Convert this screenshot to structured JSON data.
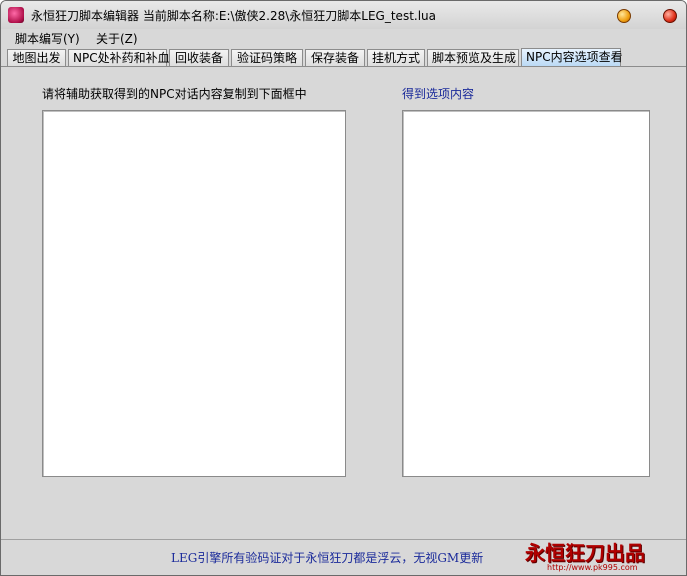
{
  "window": {
    "title": "永恒狂刀脚本编辑器    当前脚本名称:E:\\傲侠2.28\\永恒狂刀脚本LEG_test.lua"
  },
  "menu": {
    "items": [
      {
        "label": "脚本编写(Y)"
      },
      {
        "label": "关于(Z)"
      }
    ]
  },
  "tabs": [
    {
      "label": "地图出发",
      "active": false
    },
    {
      "label": "NPC处补药和补血",
      "active": false
    },
    {
      "label": "回收装备",
      "active": false
    },
    {
      "label": "验证码策略",
      "active": false
    },
    {
      "label": "保存装备",
      "active": false
    },
    {
      "label": "挂机方式",
      "active": false
    },
    {
      "label": "脚本预览及生成",
      "active": false
    },
    {
      "label": "NPC内容选项查看",
      "active": true
    }
  ],
  "panel": {
    "left_label": "请将辅助获取得到的NPC对话内容复制到下面框中",
    "right_label": "得到选项内容",
    "left_value": "",
    "right_value": ""
  },
  "footer": {
    "notice": "LEG引擎所有验码证对于永恒狂刀都是浮云，无视GM更新",
    "brand": "永恒狂刀出品",
    "brand_url": "http://www.pk995.com"
  },
  "colors": {
    "accent_text": "#1a2a9a",
    "brand_red": "#b00000",
    "active_tab": "#b8d8f4"
  }
}
